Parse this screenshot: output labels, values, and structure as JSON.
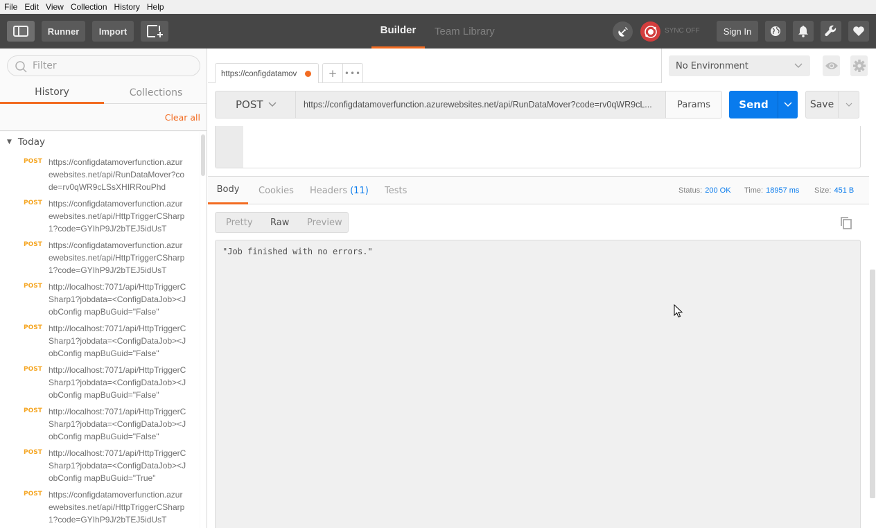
{
  "menu": [
    "File",
    "Edit",
    "View",
    "Collection",
    "History",
    "Help"
  ],
  "header": {
    "runner_label": "Runner",
    "import_label": "Import",
    "nav_tabs": [
      {
        "label": "Builder",
        "active": true
      },
      {
        "label": "Team Library",
        "active": false
      }
    ],
    "sync_status": "SYNC OFF",
    "signin_label": "Sign In",
    "icons": [
      "sidebar-toggle-icon",
      "new-window-icon",
      "satellite-icon",
      "sync-icon",
      "globe-icon",
      "bell-icon",
      "wrench-icon",
      "heart-icon"
    ]
  },
  "sidebar": {
    "filter_placeholder": "Filter",
    "tabs": [
      {
        "label": "History",
        "active": true
      },
      {
        "label": "Collections",
        "active": false
      }
    ],
    "clear_all_label": "Clear all",
    "group_label": "Today",
    "history": [
      {
        "method": "POST",
        "url": "https://configdatamoverfunction.azurewebsites.net/api/RunDataMover?code=rv0qWR9cLSsXHIRRouPhd"
      },
      {
        "method": "POST",
        "url": "https://configdatamoverfunction.azurewebsites.net/api/HttpTriggerCSharp1?code=GYIhP9J/2bTEJ5idUsT"
      },
      {
        "method": "POST",
        "url": "https://configdatamoverfunction.azurewebsites.net/api/HttpTriggerCSharp1?code=GYIhP9J/2bTEJ5idUsT"
      },
      {
        "method": "POST",
        "url": "http://localhost:7071/api/HttpTriggerCSharp1?jobdata=<ConfigDataJob><JobConfig mapBuGuid=\"False\""
      },
      {
        "method": "POST",
        "url": "http://localhost:7071/api/HttpTriggerCSharp1?jobdata=<ConfigDataJob><JobConfig mapBuGuid=\"False\""
      },
      {
        "method": "POST",
        "url": "http://localhost:7071/api/HttpTriggerCSharp1?jobdata=<ConfigDataJob><JobConfig mapBuGuid=\"False\""
      },
      {
        "method": "POST",
        "url": "http://localhost:7071/api/HttpTriggerCSharp1?jobdata=<ConfigDataJob><JobConfig mapBuGuid=\"False\""
      },
      {
        "method": "POST",
        "url": "http://localhost:7071/api/HttpTriggerCSharp1?jobdata=<ConfigDataJob><JobConfig mapBuGuid=\"True\""
      },
      {
        "method": "POST",
        "url": "https://configdatamoverfunction.azurewebsites.net/api/HttpTriggerCSharp1?code=GYIhP9J/2bTEJ5idUsT"
      }
    ]
  },
  "request": {
    "tab_title": "https://configdatamov",
    "tab_unsaved": true,
    "add_tab_label": "+",
    "more_tabs_label": "•••",
    "environment": "No Environment",
    "method": "POST",
    "url": "https://configdatamoverfunction.azurewebsites.net/api/RunDataMover?code=rv0qWR9cL...",
    "params_label": "Params",
    "send_label": "Send",
    "save_label": "Save"
  },
  "response": {
    "tabs": [
      {
        "label": "Body",
        "active": true
      },
      {
        "label": "Cookies",
        "active": false
      },
      {
        "label": "Headers",
        "count": "(11)",
        "active": false
      },
      {
        "label": "Tests",
        "active": false
      }
    ],
    "status_label": "Status:",
    "status_value": "200 OK",
    "time_label": "Time:",
    "time_value": "18957 ms",
    "size_label": "Size:",
    "size_value": "451 B",
    "view_modes": [
      {
        "label": "Pretty",
        "active": false
      },
      {
        "label": "Raw",
        "active": true
      },
      {
        "label": "Preview",
        "active": false
      }
    ],
    "body_text": "\"Job finished with no errors.\""
  },
  "colors": {
    "accent": "#f26b21",
    "send_blue": "#097bed",
    "method_post": "#f5a623",
    "sync_red": "#d33d3d",
    "header_bg": "#464646"
  }
}
